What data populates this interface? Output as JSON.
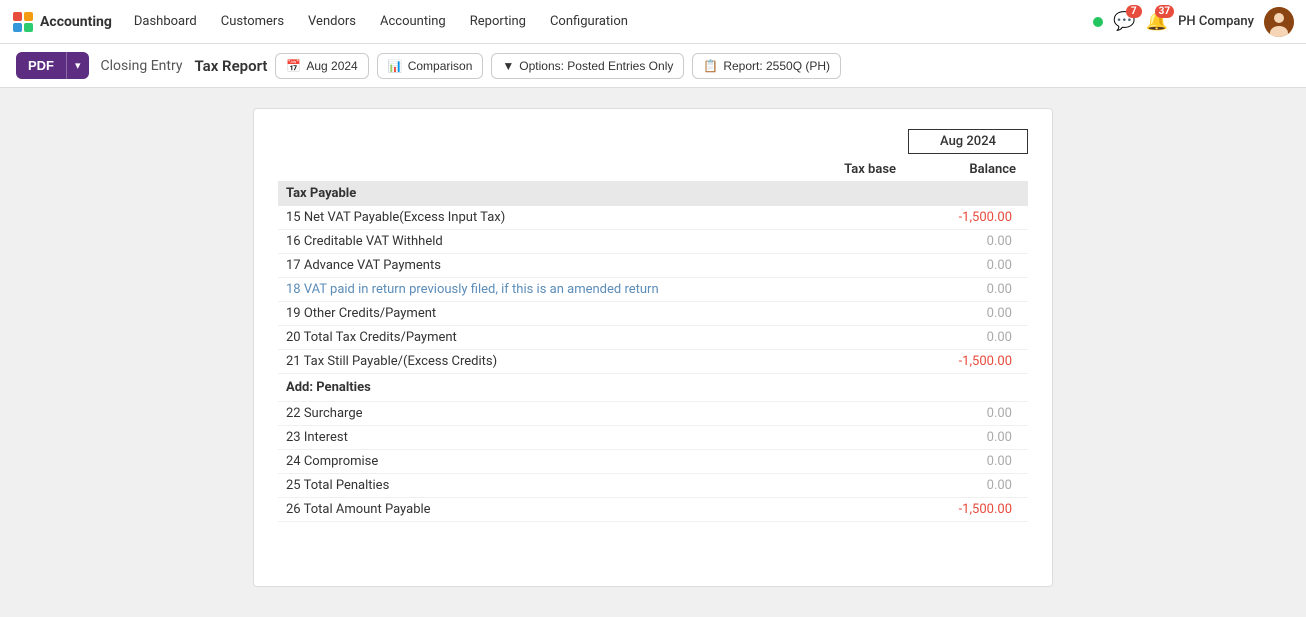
{
  "navbar": {
    "brand": "Accounting",
    "brand_icon": "X",
    "items": [
      {
        "label": "Dashboard",
        "active": false
      },
      {
        "label": "Customers",
        "active": false
      },
      {
        "label": "Vendors",
        "active": false
      },
      {
        "label": "Accounting",
        "active": false
      },
      {
        "label": "Reporting",
        "active": false
      },
      {
        "label": "Configuration",
        "active": false
      }
    ],
    "status_dot_color": "#22c55e",
    "chat_badge": "7",
    "notif_badge": "37",
    "company": "PH Company",
    "avatar_text": "👤"
  },
  "toolbar": {
    "pdf_label": "PDF",
    "closing_entry_label": "Closing Entry",
    "report_title": "Tax Report",
    "period_btn": "Aug 2024",
    "comparison_btn": "Comparison",
    "options_btn": "Options: Posted Entries Only",
    "report_btn": "Report: 2550Q (PH)"
  },
  "report": {
    "period": "Aug 2024",
    "col_tax_base": "Tax base",
    "col_balance": "Balance",
    "sections": [
      {
        "type": "section_header",
        "label": "Tax Payable"
      },
      {
        "type": "row",
        "label": "15 Net VAT Payable(Excess Input Tax)",
        "link": false,
        "tax_base": "",
        "balance": "-1,500.00",
        "balance_type": "negative"
      },
      {
        "type": "row",
        "label": "16 Creditable VAT Withheld",
        "link": false,
        "tax_base": "",
        "balance": "0.00",
        "balance_type": "zero"
      },
      {
        "type": "row",
        "label": "17 Advance VAT Payments",
        "link": false,
        "tax_base": "",
        "balance": "0.00",
        "balance_type": "zero"
      },
      {
        "type": "row",
        "label": "18 VAT paid in return previously filed, if this is an amended return",
        "link": true,
        "tax_base": "",
        "balance": "0.00",
        "balance_type": "zero"
      },
      {
        "type": "row",
        "label": "19 Other Credits/Payment",
        "link": false,
        "tax_base": "",
        "balance": "0.00",
        "balance_type": "zero"
      },
      {
        "type": "row",
        "label": "20 Total Tax Credits/Payment",
        "link": false,
        "tax_base": "",
        "balance": "0.00",
        "balance_type": "zero"
      },
      {
        "type": "row",
        "label": "21 Tax Still Payable/(Excess Credits)",
        "link": false,
        "tax_base": "",
        "balance": "-1,500.00",
        "balance_type": "negative"
      },
      {
        "type": "subsection_header",
        "label": "Add: Penalties"
      },
      {
        "type": "row",
        "label": "22 Surcharge",
        "link": false,
        "tax_base": "",
        "balance": "0.00",
        "balance_type": "zero"
      },
      {
        "type": "row",
        "label": "23 Interest",
        "link": false,
        "tax_base": "",
        "balance": "0.00",
        "balance_type": "zero"
      },
      {
        "type": "row",
        "label": "24 Compromise",
        "link": false,
        "tax_base": "",
        "balance": "0.00",
        "balance_type": "zero"
      },
      {
        "type": "row",
        "label": "25 Total Penalties",
        "link": false,
        "tax_base": "",
        "balance": "0.00",
        "balance_type": "zero"
      },
      {
        "type": "row",
        "label": "26 Total Amount Payable",
        "link": false,
        "tax_base": "",
        "balance": "-1,500.00",
        "balance_type": "negative"
      }
    ]
  }
}
